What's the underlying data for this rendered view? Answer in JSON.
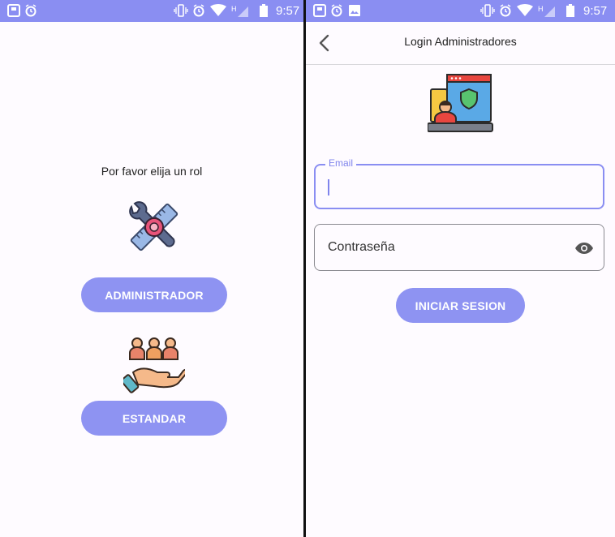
{
  "status_bar": {
    "time": "9:57"
  },
  "role_screen": {
    "prompt": "Por favor elija un rol",
    "admin_button": "ADMINISTRADOR",
    "standard_button": "ESTANDAR"
  },
  "login_screen": {
    "title": "Login Administradores",
    "email_label": "Email",
    "email_value": "",
    "password_placeholder": "Contraseña",
    "login_button": "INICIAR SESION"
  },
  "colors": {
    "accent": "#8e93f2",
    "status_bar": "#8a8ef2",
    "background": "#fefbff"
  }
}
